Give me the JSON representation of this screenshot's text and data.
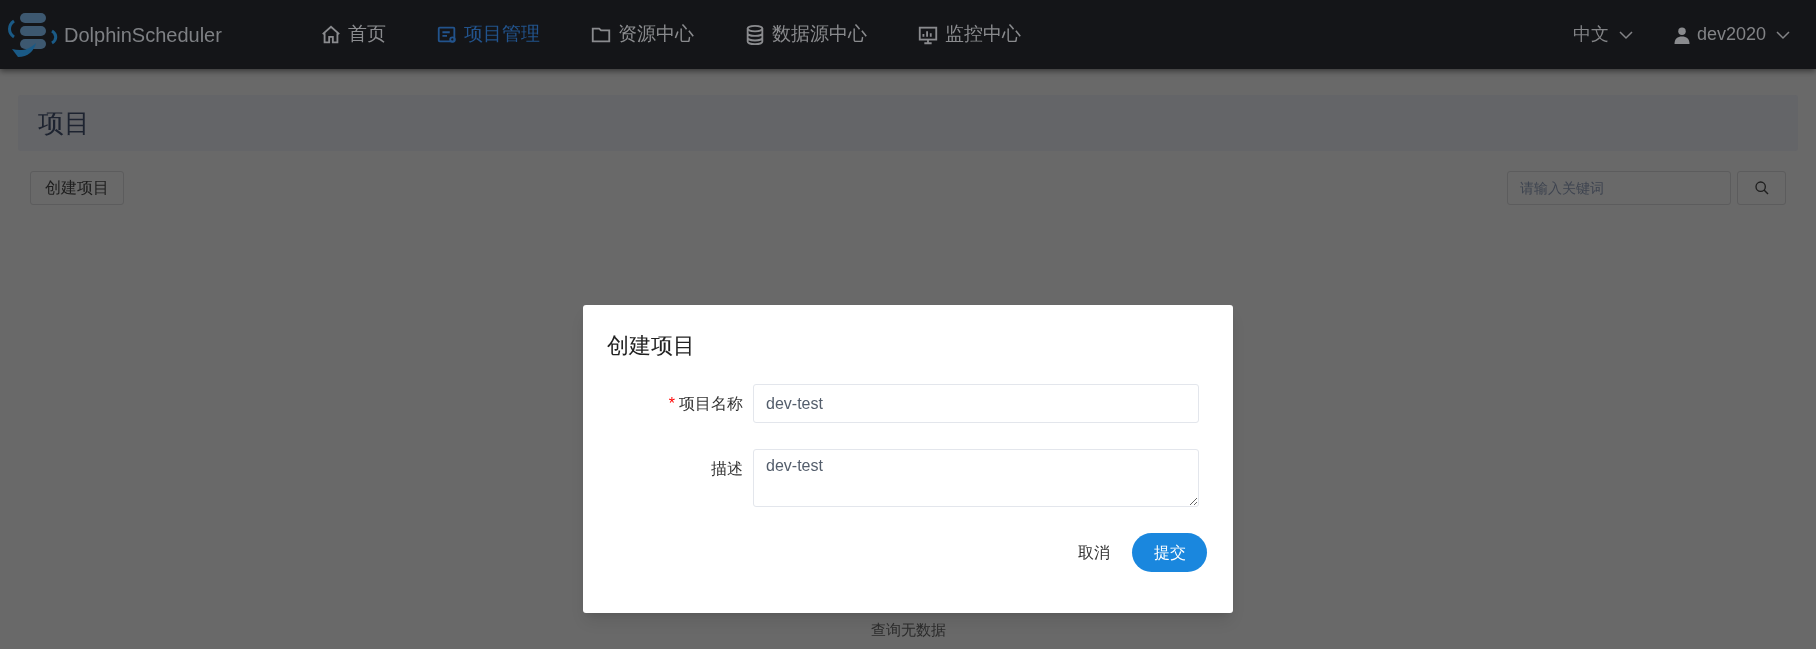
{
  "header": {
    "brand": "DolphinScheduler",
    "nav": [
      {
        "label": "首页",
        "kind": "home",
        "selected": false
      },
      {
        "label": "项目管理",
        "kind": "project",
        "selected": true
      },
      {
        "label": "资源中心",
        "kind": "folder",
        "selected": false
      },
      {
        "label": "数据源中心",
        "kind": "database",
        "selected": false
      },
      {
        "label": "监控中心",
        "kind": "monitor",
        "selected": false
      }
    ],
    "language": "中文",
    "user": "dev2020"
  },
  "page": {
    "title": "项目",
    "create_button": "创建项目",
    "search": {
      "placeholder": "请输入关键词"
    },
    "empty_text": "查询无数据"
  },
  "dialog": {
    "title": "创建项目",
    "fields": [
      {
        "label": "项目名称",
        "required_mark": "*",
        "kind": "input",
        "value": "dev-test"
      },
      {
        "label": "描述",
        "kind": "textarea",
        "value": "dev-test"
      }
    ],
    "cancel": "取消",
    "submit": "提交"
  }
}
